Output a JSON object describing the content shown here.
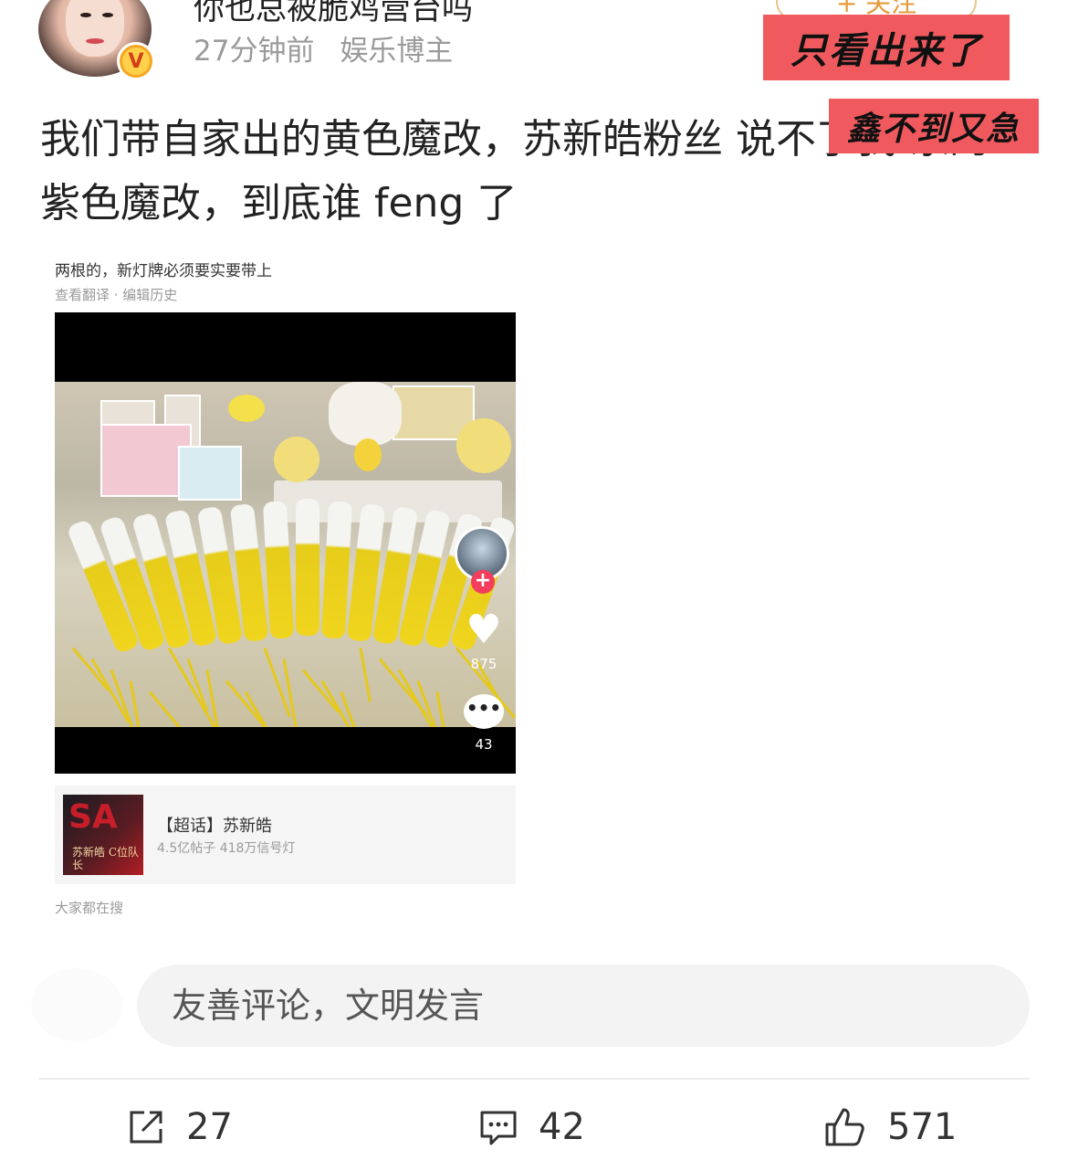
{
  "header": {
    "username": "你也总被脆鸡营台吗",
    "time": "27分钟前",
    "role": "娱乐博主",
    "follow_label": "+ 关注"
  },
  "stickers": {
    "top": "只看出来了",
    "middle": "鑫不到又急"
  },
  "post": {
    "text": "我们带自家出的黄色魔改，苏新皓粉丝 说不了我 家的紫色魔改，到底谁 feng 了"
  },
  "embed": {
    "cut_text": "两根的，新灯牌必须要实要带上",
    "links": "查看翻译 · 编辑历史",
    "video": {
      "likes": "875",
      "comments": "43"
    },
    "topic": {
      "title": "【超话】苏新皓",
      "stats": "4.5亿帖子 418万信号灯",
      "image_text": "苏新皓 C位队长"
    },
    "search_hint": "大家都在搜"
  },
  "comment_box": {
    "placeholder": "友善评论，文明发言"
  },
  "actions": {
    "share_count": "27",
    "comment_count": "42",
    "like_count": "571"
  },
  "colors": {
    "sticker_red": "#f05a5f",
    "verified_badge": "#f5a623",
    "glowstick_yellow": "#f0d51e"
  }
}
